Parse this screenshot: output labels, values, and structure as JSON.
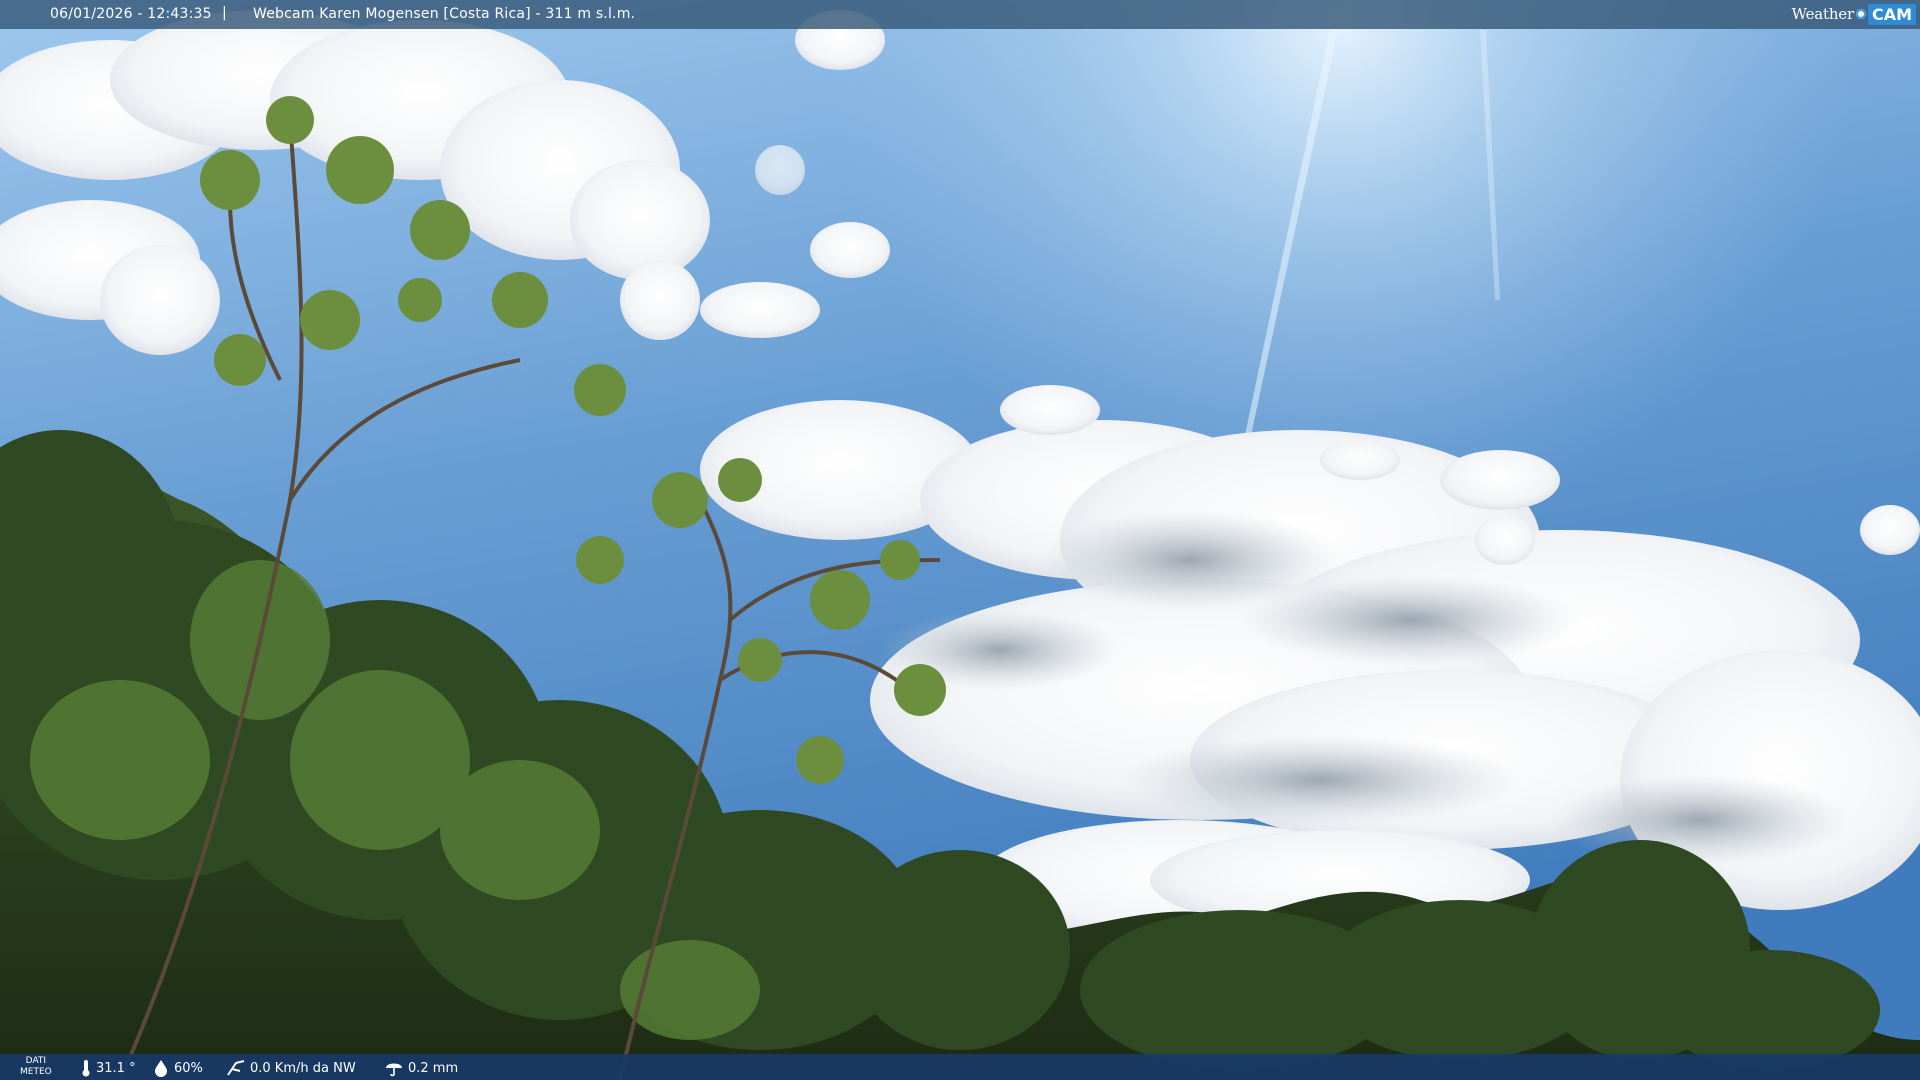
{
  "topbar": {
    "timestamp": "06/01/2026 - 12:43:35",
    "separator": "|",
    "camera_title": "Webcam Karen Mogensen [Costa Rica] - 311 m s.l.m."
  },
  "logo": {
    "word": "Weather",
    "badge": "CAM"
  },
  "bottombar": {
    "label_line1": "DATI",
    "label_line2": "METEO",
    "temperature": "31.1 °",
    "humidity": "60%",
    "wind": "0.0 Km/h da NW",
    "rain": "0.2 mm",
    "icons": [
      "thermometer-icon",
      "humidity-drop-icon",
      "wind-icon",
      "rain-icon"
    ]
  },
  "colors": {
    "sky_top": "#7fb6e6",
    "sky_bottom": "#4a86c4",
    "bar": "#183868"
  }
}
